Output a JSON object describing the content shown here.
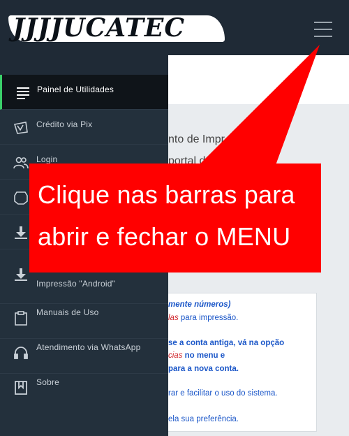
{
  "header": {
    "logo_text": "JJJJUCATEC"
  },
  "sidebar": {
    "items": [
      {
        "label": "Painel de Utilidades",
        "icon": "list-icon"
      },
      {
        "label": "Crédito via Pix",
        "icon": "pix-icon"
      },
      {
        "label": "Login",
        "icon": "users-icon"
      },
      {
        "label": "",
        "icon": "shield-icon"
      },
      {
        "label": "",
        "icon": "download-icon"
      },
      {
        "label": "Impressão \"Android\"",
        "icon": "download-icon"
      },
      {
        "label": "Manuais de Uso",
        "icon": "clipboard-icon"
      },
      {
        "label": "Atendimento via WhatsApp",
        "icon": "headset-icon"
      },
      {
        "label": "Sobre",
        "icon": "bookmark-icon"
      }
    ]
  },
  "main": {
    "heading_line1": "nto de Impr",
    "heading_line2": "portal d",
    "card": {
      "line1": "mente números)",
      "line2_red": "las",
      "line2_rest": " para impressão.",
      "line3": "se a conta antiga, vá na opção",
      "line4_red": "cias",
      "line4_rest": " no menu e",
      "line5": " para a nova conta.",
      "line6": "rar e facilitar o uso do sistema.",
      "line7": "ela sua preferência."
    }
  },
  "callout": {
    "line1": "Clique nas barras para",
    "line2": "abrir e fechar o MENU"
  },
  "colors": {
    "callout": "#ff0000",
    "active_indicator": "#3ad06a",
    "sidebar": "#23303c"
  }
}
